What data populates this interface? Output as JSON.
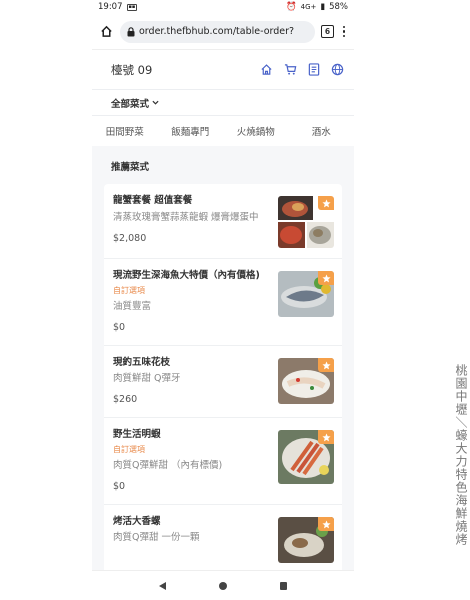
{
  "status_bar": {
    "time": "19:07",
    "sim": "4G",
    "signal": "4G+",
    "battery": "58%"
  },
  "browser": {
    "url": "order.thefbhub.com/table-order?",
    "tab_count": "6"
  },
  "header": {
    "table_label": "檯號 09",
    "icons": [
      "home-icon",
      "cart-icon",
      "order-list-icon",
      "globe-icon"
    ],
    "accent_color": "#4a63c9"
  },
  "category": {
    "selected": "全部菜式"
  },
  "tabs": [
    {
      "label": "田間野菜"
    },
    {
      "label": "飯麵專門"
    },
    {
      "label": "火燒鍋物"
    },
    {
      "label": "酒水"
    }
  ],
  "section": {
    "title": "推薦菜式"
  },
  "items": [
    {
      "name": "龍蟹套餐 超值套餐",
      "tag": "",
      "desc": "清蒸玫瑰膏蟹蒜蒸龍蝦 爆膏爆蛋中",
      "price": "$2,080"
    },
    {
      "name": "現流野生深海魚大特價（內有價格)",
      "tag": "自訂選項",
      "desc": "油質豐富",
      "price": "$0"
    },
    {
      "name": "現釣五味花枝",
      "tag": "",
      "desc": "肉質鮮甜 Q彈牙",
      "price": "$260"
    },
    {
      "name": "野生活明蝦",
      "tag": "自訂選項",
      "desc": "肉質Q彈鮮甜 （內有標價)",
      "price": "$0"
    },
    {
      "name": "烤活大香螺",
      "tag": "",
      "desc": "肉質Q彈甜 一份一顆",
      "price": ""
    }
  ],
  "badge_color": "#f5a04a",
  "tag_color": "#e8894a",
  "side_caption": "桃園中壢＼蠔大力特色海鮮燒烤"
}
